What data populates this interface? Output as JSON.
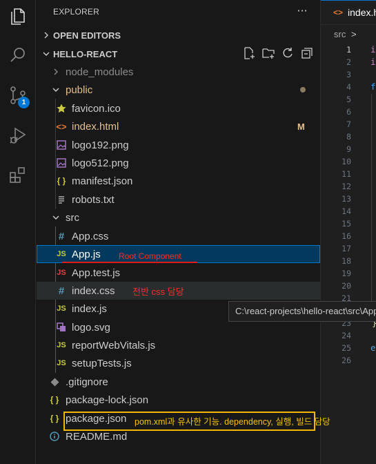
{
  "explorer": {
    "title": "EXPLORER",
    "open_editors": "OPEN EDITORS",
    "project": "HELLO-REACT"
  },
  "tree": {
    "node_modules": "node_modules",
    "public": "public",
    "favicon": "favicon.ico",
    "index_html": "index.html",
    "index_html_status": "M",
    "logo192": "logo192.png",
    "logo512": "logo512.png",
    "manifest": "manifest.json",
    "robots": "robots.txt",
    "src": "src",
    "app_css": "App.css",
    "app_js": "App.js",
    "app_test": "App.test.js",
    "index_css": "index.css",
    "index_js": "index.js",
    "logo_svg": "logo.svg",
    "report": "reportWebVitals.js",
    "setup": "setupTests.js",
    "gitignore": ".gitignore",
    "package_lock": "package-lock.json",
    "package_json": "package.json",
    "readme": "README.md"
  },
  "annotations": {
    "root_component": "Root Component",
    "css_owner": "전반 css 담당",
    "package_desc": "pom.xml과 유사한 기능. dependency, 실행, 빌드 담당"
  },
  "tooltip": "C:\\react-projects\\hello-react\\src\\App.js",
  "editor": {
    "tab_title": "index.html",
    "tab_icon": "<>",
    "breadcrumb": "src",
    "breadcrumb_sep": ">",
    "line_numbers": [
      "1",
      "2",
      "3",
      "4",
      "5",
      "6",
      "7",
      "8",
      "9",
      "10",
      "11",
      "12",
      "13",
      "14",
      "15",
      "16",
      "17",
      "18",
      "19",
      "20",
      "21",
      "22",
      "23",
      "24",
      "25",
      "26"
    ],
    "code_fragments": {
      "l1": "i",
      "l2": "i",
      "l4": "f",
      "l23": "}",
      "l25": "e"
    }
  },
  "badges": {
    "source_control": "1"
  },
  "colors": {
    "accent": "#0078d4",
    "annotation_red": "#ff2a2a",
    "annotation_yellow": "#f5c400",
    "modified": "#e2c08d",
    "js_icon": "#cbcb41"
  },
  "icons": {
    "js_label": "JS",
    "css_label": "#",
    "json_label": "{ }",
    "html_label": "<>",
    "more": "···"
  }
}
